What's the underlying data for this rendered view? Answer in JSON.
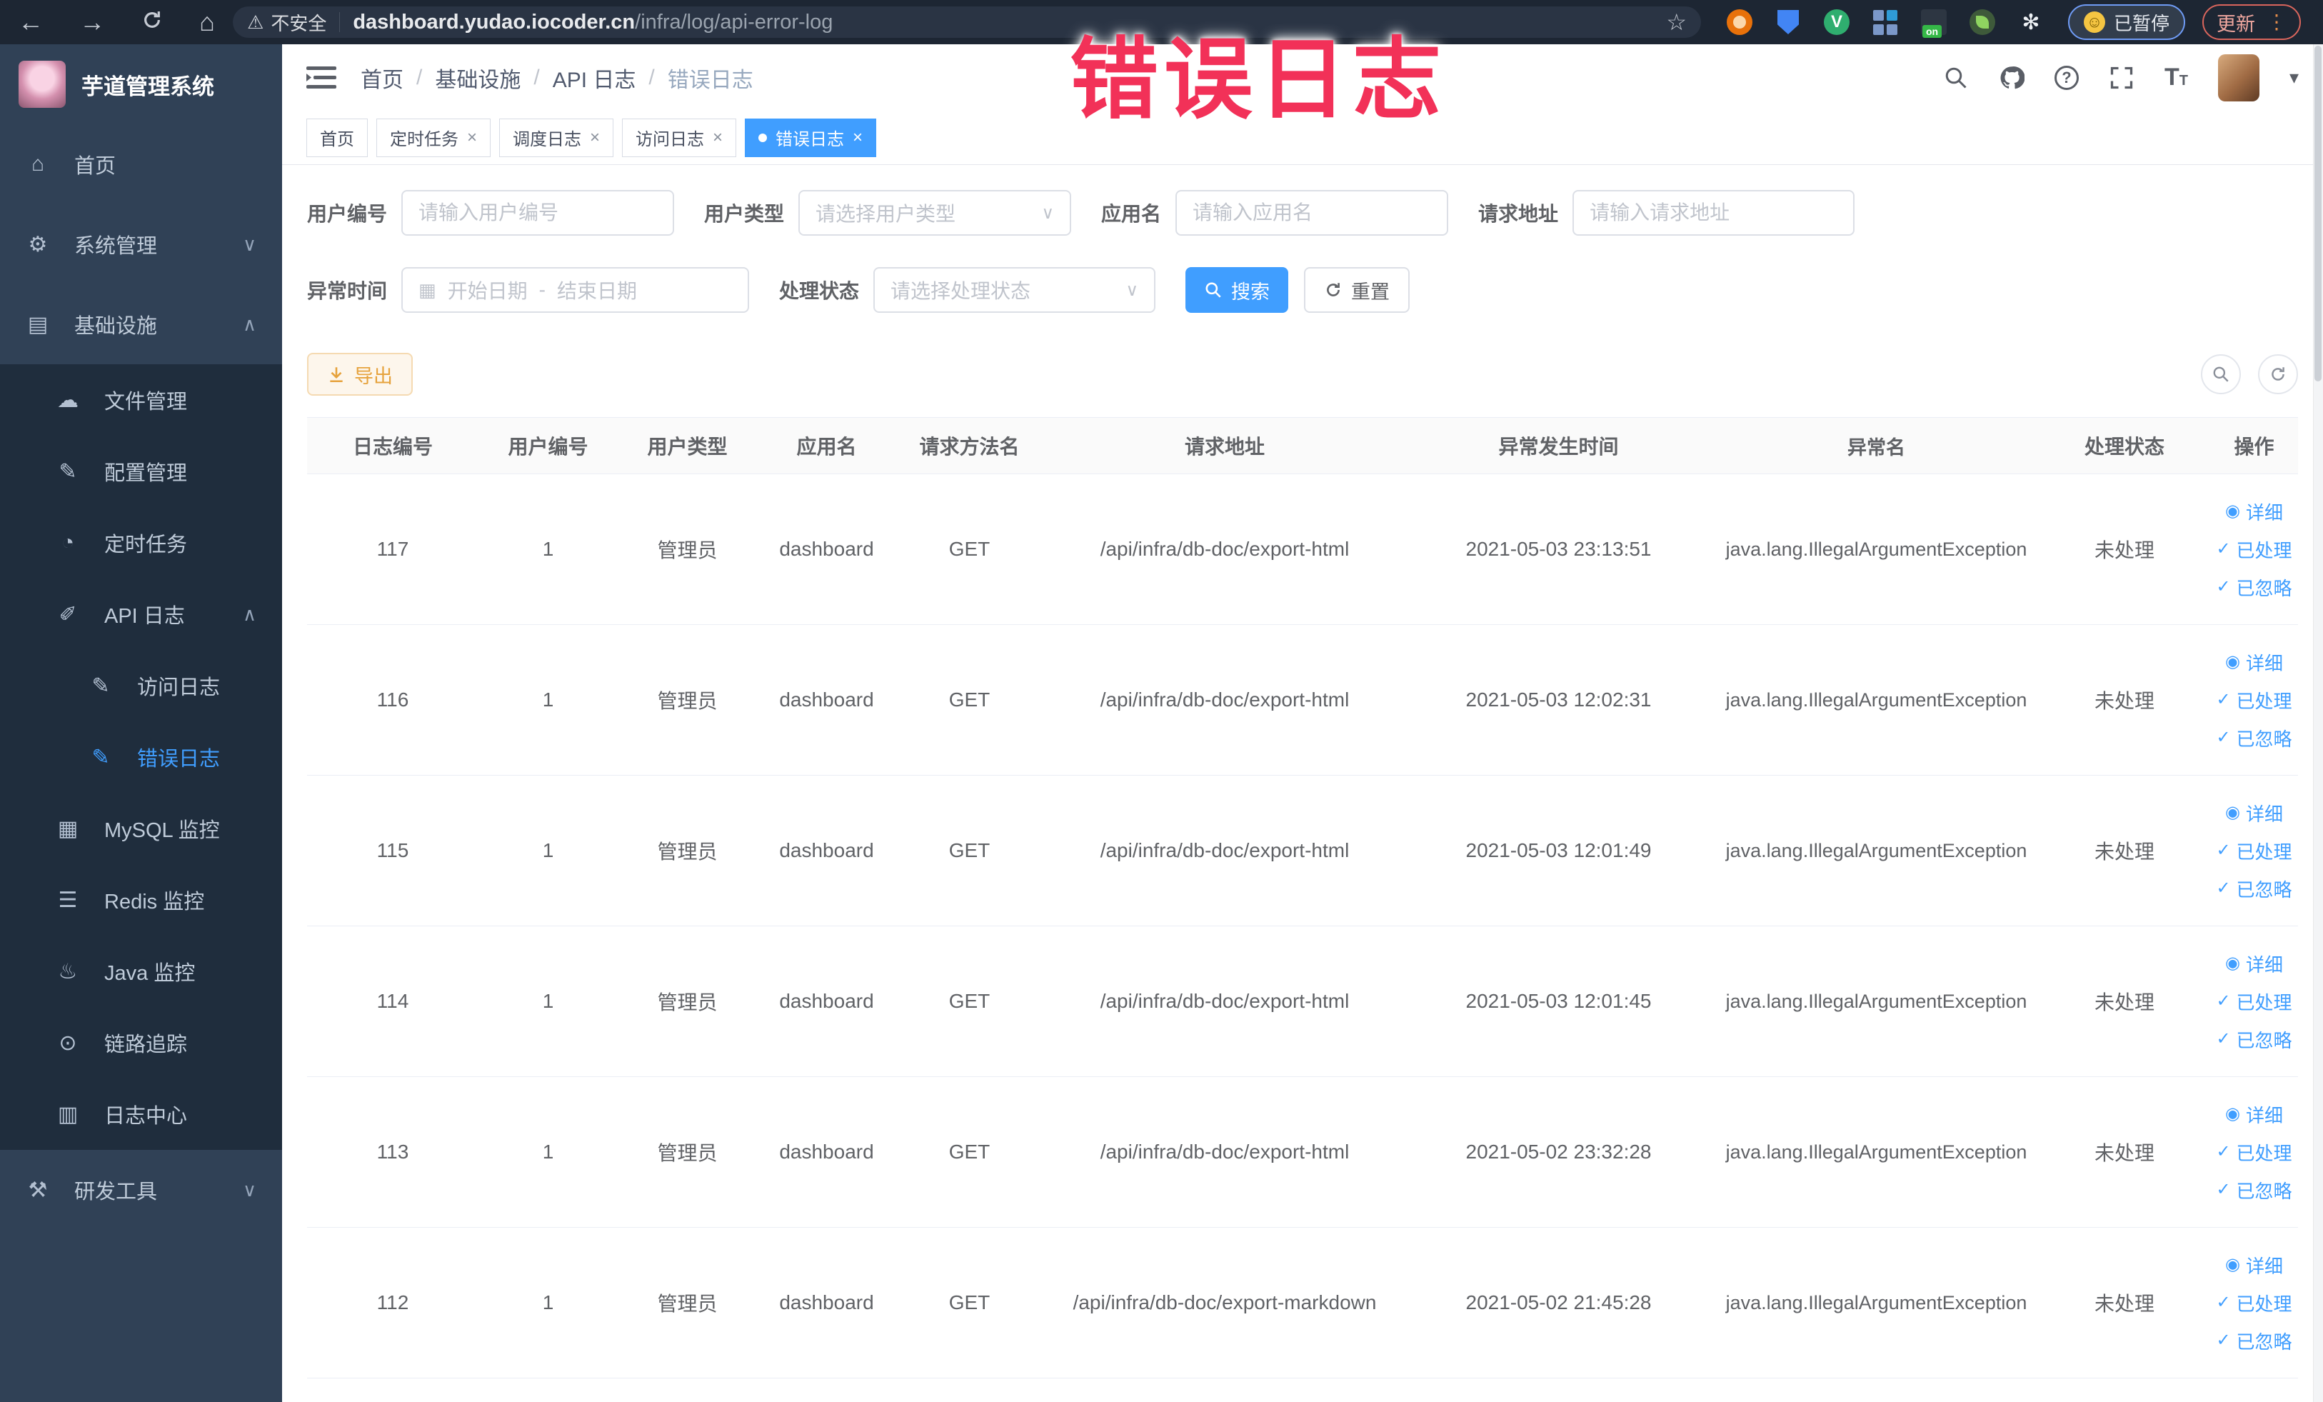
{
  "browser": {
    "security_label": "不安全",
    "url_domain": "dashboard.yudao.iocoder.cn",
    "url_path": "/infra/log/api-error-log",
    "paused_label": "已暂停",
    "update_label": "更新"
  },
  "annotation": {
    "text": "错误日志"
  },
  "sidebar": {
    "title": "芋道管理系统",
    "items": [
      {
        "label": "首页",
        "icon": "⌂"
      },
      {
        "label": "系统管理",
        "icon": "⚙"
      },
      {
        "label": "基础设施",
        "icon": "▤"
      },
      {
        "label": "文件管理",
        "icon": "☁"
      },
      {
        "label": "配置管理",
        "icon": "✎"
      },
      {
        "label": "定时任务",
        "icon": "◔"
      },
      {
        "label": "API 日志",
        "icon": "✐"
      },
      {
        "label": "访问日志",
        "icon": "✎"
      },
      {
        "label": "错误日志",
        "icon": "✎"
      },
      {
        "label": "MySQL 监控",
        "icon": "▦"
      },
      {
        "label": "Redis 监控",
        "icon": "☰"
      },
      {
        "label": "Java 监控",
        "icon": "♨"
      },
      {
        "label": "链路追踪",
        "icon": "⊙"
      },
      {
        "label": "日志中心",
        "icon": "▥"
      },
      {
        "label": "研发工具",
        "icon": "⚒"
      }
    ]
  },
  "header": {
    "breadcrumb": [
      "首页",
      "基础设施",
      "API 日志",
      "错误日志"
    ]
  },
  "tabs": {
    "items": [
      {
        "label": "首页"
      },
      {
        "label": "定时任务"
      },
      {
        "label": "调度日志"
      },
      {
        "label": "访问日志"
      },
      {
        "label": "错误日志"
      }
    ]
  },
  "filters": {
    "user_id_label": "用户编号",
    "user_id_placeholder": "请输入用户编号",
    "user_type_label": "用户类型",
    "user_type_placeholder": "请选择用户类型",
    "app_name_label": "应用名",
    "app_name_placeholder": "请输入应用名",
    "request_url_label": "请求地址",
    "request_url_placeholder": "请输入请求地址",
    "exception_time_label": "异常时间",
    "date_start_placeholder": "开始日期",
    "date_separator": "-",
    "date_end_placeholder": "结束日期",
    "process_status_label": "处理状态",
    "process_status_placeholder": "请选择处理状态",
    "search_label": "搜索",
    "reset_label": "重置"
  },
  "toolbar": {
    "export_label": "导出"
  },
  "table": {
    "columns": [
      "日志编号",
      "用户编号",
      "用户类型",
      "应用名",
      "请求方法名",
      "请求地址",
      "异常发生时间",
      "异常名",
      "处理状态",
      "操作"
    ],
    "actions": {
      "detail": "详细",
      "processed": "已处理",
      "ignored": "已忽略"
    },
    "rows": [
      {
        "id": "117",
        "user_id": "1",
        "user_type": "管理员",
        "app": "dashboard",
        "method": "GET",
        "url": "/api/infra/db-doc/export-html",
        "time": "2021-05-03 23:13:51",
        "exception": "java.lang.IllegalArgumentException",
        "status": "未处理"
      },
      {
        "id": "116",
        "user_id": "1",
        "user_type": "管理员",
        "app": "dashboard",
        "method": "GET",
        "url": "/api/infra/db-doc/export-html",
        "time": "2021-05-03 12:02:31",
        "exception": "java.lang.IllegalArgumentException",
        "status": "未处理"
      },
      {
        "id": "115",
        "user_id": "1",
        "user_type": "管理员",
        "app": "dashboard",
        "method": "GET",
        "url": "/api/infra/db-doc/export-html",
        "time": "2021-05-03 12:01:49",
        "exception": "java.lang.IllegalArgumentException",
        "status": "未处理"
      },
      {
        "id": "114",
        "user_id": "1",
        "user_type": "管理员",
        "app": "dashboard",
        "method": "GET",
        "url": "/api/infra/db-doc/export-html",
        "time": "2021-05-03 12:01:45",
        "exception": "java.lang.IllegalArgumentException",
        "status": "未处理"
      },
      {
        "id": "113",
        "user_id": "1",
        "user_type": "管理员",
        "app": "dashboard",
        "method": "GET",
        "url": "/api/infra/db-doc/export-html",
        "time": "2021-05-02 23:32:28",
        "exception": "java.lang.IllegalArgumentException",
        "status": "未处理"
      },
      {
        "id": "112",
        "user_id": "1",
        "user_type": "管理员",
        "app": "dashboard",
        "method": "GET",
        "url": "/api/infra/db-doc/export-markdown",
        "time": "2021-05-02 21:45:28",
        "exception": "java.lang.IllegalArgumentException",
        "status": "未处理"
      }
    ]
  },
  "colors": {
    "accent": "#409eff",
    "sidebar_bg": "#304156",
    "submenu_bg": "#1f2d3d",
    "warning": "#e6a23c",
    "annotation_red": "#f23158"
  }
}
